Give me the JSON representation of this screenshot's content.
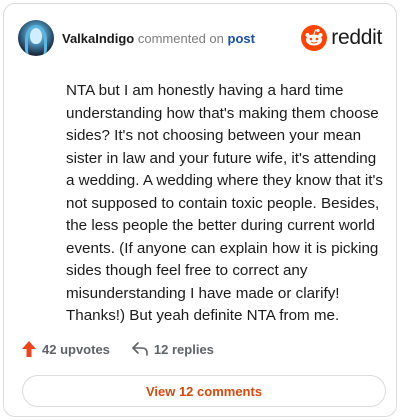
{
  "header": {
    "username": "ValkaIndigo",
    "action_text": "commented on",
    "target_link": "post",
    "brand_name": "reddit",
    "brand_color": "#ff4500"
  },
  "comment": {
    "text": "NTA but I am honestly having a hard time understanding how that's making them choose sides? It's not choosing between your mean sister in law and your future wife, it's attending a wedding. A wedding where they know that it's not supposed to contain toxic people. Besides, the less people the better during current world events. (If anyone can explain how it is picking sides though feel free to correct any misunderstanding I have made or clarify! Thanks!) But yeah definite NTA from me."
  },
  "stats": {
    "upvotes": "42 upvotes",
    "replies": "12 replies"
  },
  "footer": {
    "view_button": "View 12 comments"
  },
  "colors": {
    "accent": "#d14a0e",
    "upvote_icon": "#e8471c",
    "text": "#1a1a1b",
    "muted": "#7c7c7c",
    "link": "#1a4fa3"
  },
  "icons": [
    "user-avatar",
    "reddit-logo",
    "upvote-arrow-icon",
    "reply-icon"
  ]
}
